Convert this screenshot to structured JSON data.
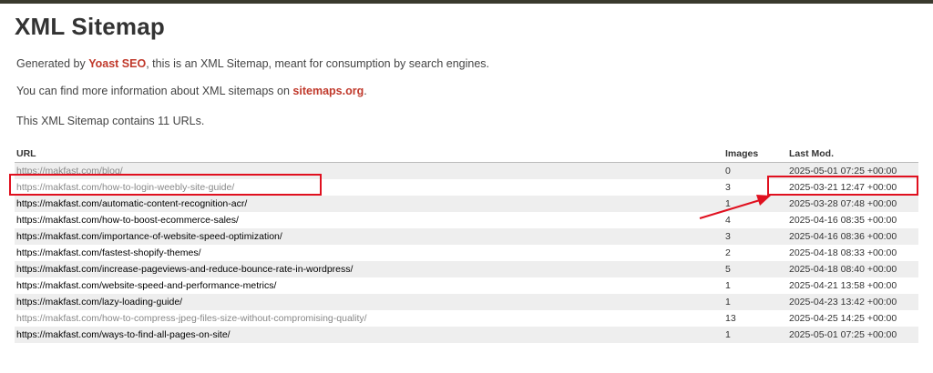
{
  "page": {
    "title": "XML Sitemap",
    "intro": {
      "line1_prefix": "Generated by ",
      "line1_link": "Yoast SEO",
      "line1_suffix": ", this is an XML Sitemap, meant for consumption by search engines.",
      "line2_prefix": "You can find more information about XML sitemaps on ",
      "line2_link": "sitemaps.org",
      "line2_suffix": ".",
      "line3": "This XML Sitemap contains 11 URLs."
    }
  },
  "table": {
    "headers": {
      "url": "URL",
      "images": "Images",
      "lastmod": "Last Mod."
    },
    "rows": [
      {
        "url": "https://makfast.com/blog/",
        "images": "0",
        "lastmod": "2025-05-01 07:25 +00:00",
        "visited": true
      },
      {
        "url": "https://makfast.com/how-to-login-weebly-site-guide/",
        "images": "3",
        "lastmod": "2025-03-21 12:47 +00:00",
        "visited": true
      },
      {
        "url": "https://makfast.com/automatic-content-recognition-acr/",
        "images": "1",
        "lastmod": "2025-03-28 07:48 +00:00",
        "visited": false
      },
      {
        "url": "https://makfast.com/how-to-boost-ecommerce-sales/",
        "images": "4",
        "lastmod": "2025-04-16 08:35 +00:00",
        "visited": false
      },
      {
        "url": "https://makfast.com/importance-of-website-speed-optimization/",
        "images": "3",
        "lastmod": "2025-04-16 08:36 +00:00",
        "visited": false
      },
      {
        "url": "https://makfast.com/fastest-shopify-themes/",
        "images": "2",
        "lastmod": "2025-04-18 08:33 +00:00",
        "visited": false
      },
      {
        "url": "https://makfast.com/increase-pageviews-and-reduce-bounce-rate-in-wordpress/",
        "images": "5",
        "lastmod": "2025-04-18 08:40 +00:00",
        "visited": false
      },
      {
        "url": "https://makfast.com/website-speed-and-performance-metrics/",
        "images": "1",
        "lastmod": "2025-04-21 13:58 +00:00",
        "visited": false
      },
      {
        "url": "https://makfast.com/lazy-loading-guide/",
        "images": "1",
        "lastmod": "2025-04-23 13:42 +00:00",
        "visited": false
      },
      {
        "url": "https://makfast.com/how-to-compress-jpeg-files-size-without-compromising-quality/",
        "images": "13",
        "lastmod": "2025-04-25 14:25 +00:00",
        "visited": true
      },
      {
        "url": "https://makfast.com/ways-to-find-all-pages-on-site/",
        "images": "1",
        "lastmod": "2025-05-01 07:25 +00:00",
        "visited": false
      }
    ]
  },
  "colors": {
    "link_accent": "#c0392b",
    "annotation": "#e0101f",
    "top_bar": "#3a3a2e",
    "row_alt": "#eeeeee"
  }
}
